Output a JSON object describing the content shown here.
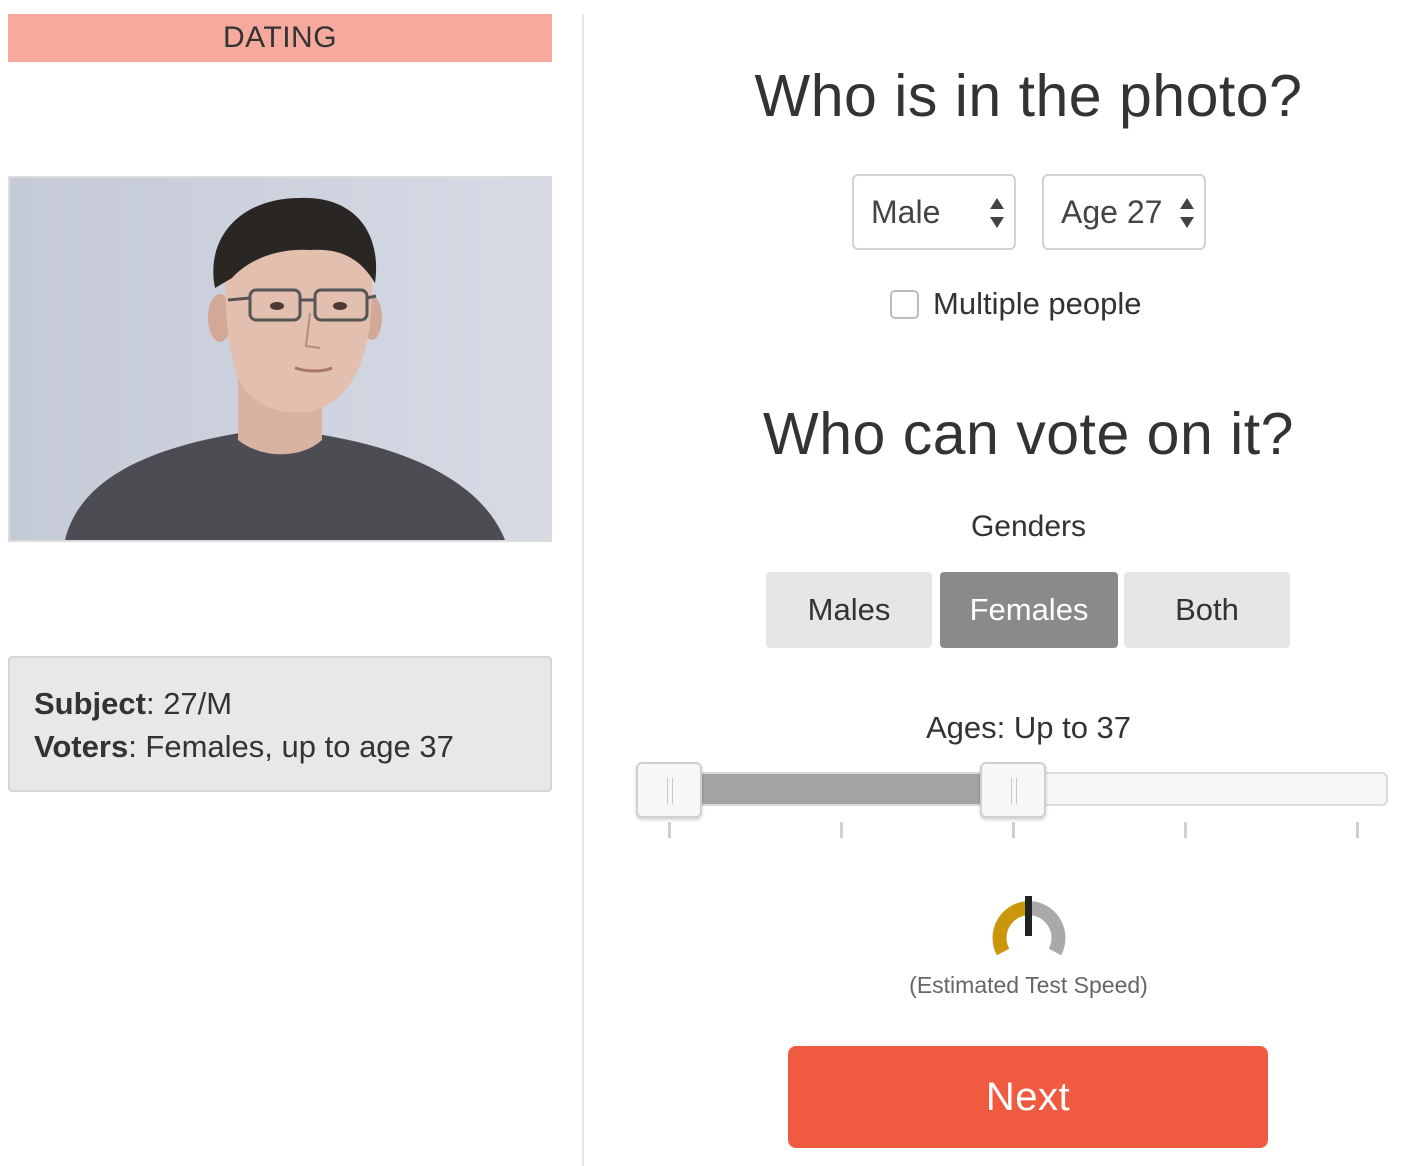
{
  "category": {
    "label": "DATING",
    "color": "#f6aa9d"
  },
  "summary": {
    "subject_label": "Subject",
    "subject_value": ": 27/M",
    "voters_label": "Voters",
    "voters_value": ": Females, up to age 37"
  },
  "photo_section": {
    "heading": "Who is in the photo?",
    "gender_select": {
      "value": "Male"
    },
    "age_select": {
      "value": "Age 27"
    },
    "multiple_people": {
      "label": "Multiple people",
      "checked": false
    }
  },
  "vote_section": {
    "heading": "Who can vote on it?",
    "genders_label": "Genders",
    "gender_options": [
      {
        "label": "Males",
        "selected": false
      },
      {
        "label": "Females",
        "selected": true
      },
      {
        "label": "Both",
        "selected": false
      }
    ],
    "ages_label": "Ages: Up to 37",
    "age_slider": {
      "selected_range_fraction": [
        0.0,
        0.5
      ],
      "tick_count": 5
    }
  },
  "speed": {
    "label": "(Estimated Test Speed)",
    "gauge_fraction": 0.5,
    "colors": {
      "filled": "#c9960c",
      "empty": "#a9a9a9",
      "needle": "#222222"
    }
  },
  "next_button": {
    "label": "Next",
    "color": "#f05a40"
  },
  "icons": [
    "select-arrows-icon",
    "speed-gauge-icon",
    "slider-grip-icon"
  ]
}
